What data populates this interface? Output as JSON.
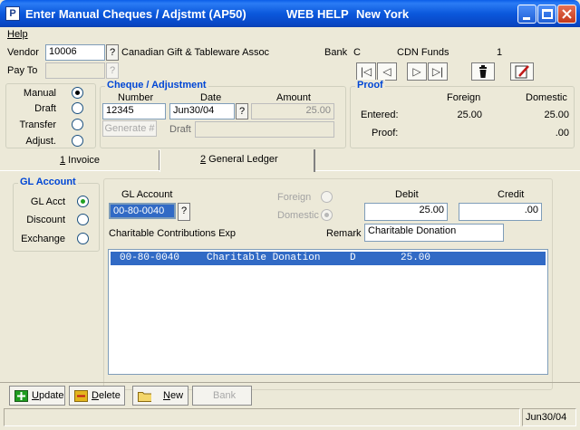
{
  "window": {
    "title": "Enter Manual Cheques / Adjstmt (AP50)",
    "web_help": "WEB HELP",
    "location": "New York"
  },
  "menu": {
    "help": "Help"
  },
  "vendor": {
    "label": "Vendor",
    "value": "10006",
    "name": "Canadian Gift & Tableware Assoc",
    "lookup_label": "?"
  },
  "pay_to": {
    "label": "Pay To",
    "value": "",
    "lookup_label": "?"
  },
  "bank": {
    "label": "Bank",
    "code": "C",
    "name": "CDN Funds",
    "number": "1"
  },
  "nav": {
    "first": "|◁",
    "prev": "◁",
    "next": "▷",
    "last": "▷|"
  },
  "type_options": [
    {
      "label": "Manual",
      "selected": true
    },
    {
      "label": "Draft",
      "selected": false
    },
    {
      "label": "Transfer",
      "selected": false
    },
    {
      "label": "Adjust.",
      "selected": false
    }
  ],
  "cheque": {
    "title": "Cheque / Adjustment",
    "number_label": "Number",
    "date_label": "Date",
    "amount_label": "Amount",
    "number": "12345",
    "date": "Jun30/04",
    "date_lookup": "?",
    "amount": "25.00",
    "generate_label": "Generate #",
    "draft_label": "Draft",
    "draft_value": ""
  },
  "proof": {
    "title": "Proof",
    "foreign_label": "Foreign",
    "domestic_label": "Domestic",
    "entered_label": "Entered:",
    "entered_foreign": "25.00",
    "entered_domestic": "25.00",
    "proof_label": "Proof:",
    "proof_domestic": ".00"
  },
  "tabs": [
    {
      "label": "1 Invoice",
      "key": "1",
      "rest": " Invoice",
      "active": false
    },
    {
      "label": "2 General Ledger",
      "key": "2",
      "rest": " General Ledger",
      "active": true
    }
  ],
  "gl_account_group": {
    "title": "GL Account",
    "options": [
      {
        "label": "GL Acct",
        "selected": true
      },
      {
        "label": "Discount",
        "selected": false
      },
      {
        "label": "Exchange",
        "selected": false
      }
    ]
  },
  "entry": {
    "gl_account_label": "GL Account",
    "gl_account_value": "00-80-0040",
    "gl_lookup": "?",
    "foreign_label": "Foreign",
    "domestic_label": "Domestic",
    "debit_label": "Debit",
    "credit_label": "Credit",
    "debit_value": "25.00",
    "credit_value": ".00",
    "account_description": "Charitable Contributions Exp",
    "remark_label": "Remark",
    "remark_value": "Charitable Donation"
  },
  "list_rows": [
    {
      "account": "00-80-0040",
      "description": "Charitable Donation",
      "dc": "D",
      "amount": "25.00",
      "selected": true
    }
  ],
  "toolbar": {
    "update": "Update",
    "update_key": "U",
    "update_rest": "pdate",
    "delete": "Delete",
    "delete_key": "D",
    "delete_rest": "elete",
    "new": "New",
    "new_key": "N",
    "new_rest": "ew",
    "bank": "Bank"
  },
  "status": {
    "date": "Jun30/04"
  },
  "colors": {
    "title_bar": "#0a5ee8",
    "group_title": "#0046d5",
    "selection": "#316ac5"
  }
}
